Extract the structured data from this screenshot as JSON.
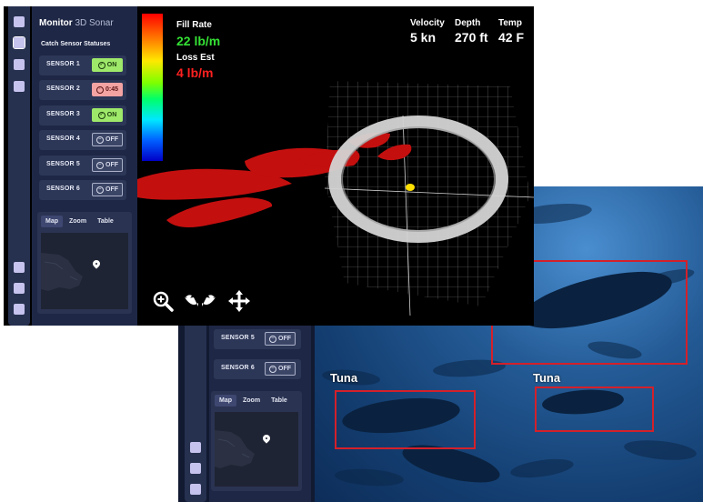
{
  "app": {
    "title": "Monitor",
    "subtitle": "3D Sonar"
  },
  "sensors_heading": "Catch Sensor Statuses",
  "sensors": [
    {
      "label": "SENSOR 1",
      "status": "ON",
      "kind": "on"
    },
    {
      "label": "SENSOR 2",
      "status": "0:45",
      "kind": "timer"
    },
    {
      "label": "SENSOR 3",
      "status": "ON",
      "kind": "on"
    },
    {
      "label": "SENSOR 4",
      "status": "OFF",
      "kind": "off"
    },
    {
      "label": "SENSOR 5",
      "status": "OFF",
      "kind": "off"
    },
    {
      "label": "SENSOR 6",
      "status": "OFF",
      "kind": "off"
    }
  ],
  "map_tabs": [
    "Map",
    "Zoom",
    "Table"
  ],
  "readouts": {
    "fill_rate_label": "Fill Rate",
    "fill_rate_value": "22 lb/m",
    "loss_label": "Loss Est",
    "loss_value": "4 lb/m",
    "velocity_label": "Velocity",
    "velocity_value": "5 kn",
    "depth_label": "Depth",
    "depth_value": "270 ft",
    "temp_label": "Temp",
    "temp_value": "42 F"
  },
  "detections": [
    {
      "label": "Tuna"
    },
    {
      "label": "Tuna"
    },
    {
      "label": ""
    }
  ],
  "colors": {
    "fill_rate": "#34e034",
    "loss": "#ff2020",
    "detection_box": "#d4202a",
    "status_on": "#9ee86a",
    "status_timer": "#f4a3a3"
  },
  "icons": {
    "zoom": "magnifier-plus-icon",
    "rotate": "rotate-arrows-icon",
    "pan": "move-cross-icon",
    "status_on": "check-circle-icon",
    "status_timer": "clock-icon",
    "status_off": "minus-circle-icon",
    "map_marker": "map-pin-icon"
  }
}
